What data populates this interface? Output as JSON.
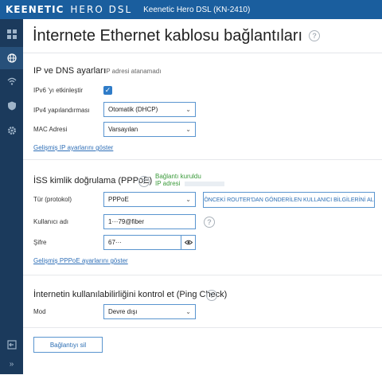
{
  "brand": {
    "name": "KEENETIC",
    "product": "HERO DSL",
    "model": "Keenetic Hero DSL (KN-2410)"
  },
  "page": {
    "title": "İnternete Ethernet kablosu bağlantıları"
  },
  "ip_section": {
    "title": "IP ve DNS ayarları",
    "hint": "IP adresi atanamadı",
    "ipv6_label": "IPv6 'yı etkinleştir",
    "ipv4_label": "IPv4 yapılandırması",
    "ipv4_value": "Otomatik (DHCP)",
    "mac_label": "MAC Adresi",
    "mac_value": "Varsayılan",
    "advanced_link": "Gelişmiş IP ayarlarını göster"
  },
  "pppoe_section": {
    "title": "İSS kimlik doğrulama (PPPoE)",
    "status_line1": "Bağlantı kuruldu",
    "status_line2": "IP adresi",
    "protocol_label": "Tür (protokol)",
    "protocol_value": "PPPoE",
    "send_button": "ÖNCEKİ ROUTER'DAN GÖNDERİLEN KULLANICI BİLGİLERİNİ AL",
    "username_label": "Kullanıcı adı",
    "username_value": "1···79@fiber",
    "password_label": "Şifre",
    "password_value": "67···",
    "advanced_link": "Gelişmiş PPPoE ayarlarını göster"
  },
  "ping_section": {
    "title": "İnternetin kullanılabilirliğini kontrol et (Ping Check)",
    "mode_label": "Mod",
    "mode_value": "Devre dışı"
  },
  "actions": {
    "delete_button": "Bağlantıyı sil"
  }
}
